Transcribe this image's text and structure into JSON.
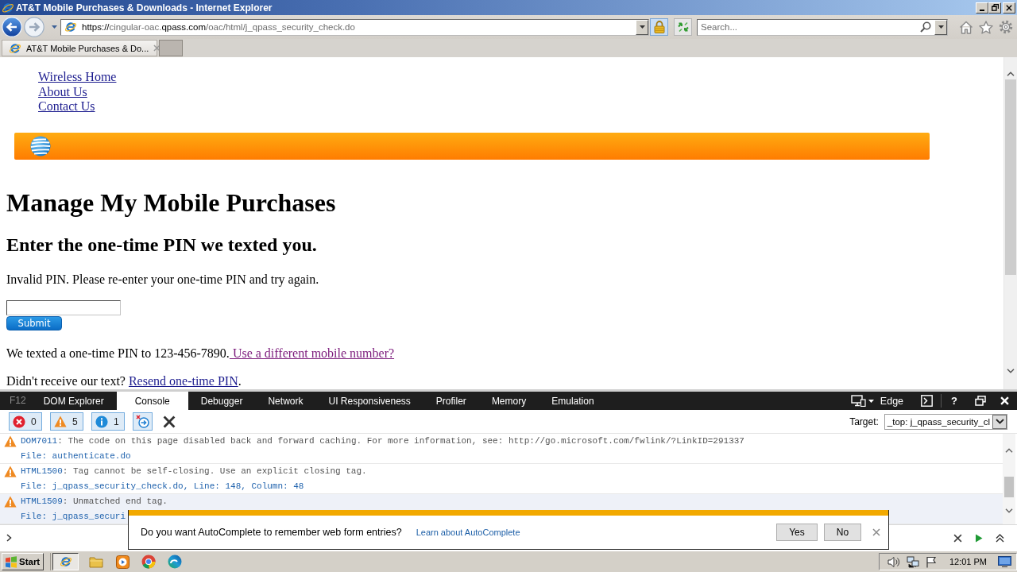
{
  "window": {
    "title": "AT&T Mobile Purchases & Downloads - Internet Explorer"
  },
  "address_bar": {
    "url": {
      "scheme": "https://",
      "host_prefix": "cingular-oac.",
      "domain": "qpass.com",
      "path": "/oac/html/j_qpass_security_check.do"
    }
  },
  "search": {
    "placeholder": "Search..."
  },
  "tabs": [
    {
      "title": "AT&T Mobile Purchases & Do...",
      "selected": true
    }
  ],
  "page": {
    "nav_links": [
      "Wireless Home",
      "About Us",
      "Contact Us"
    ],
    "heading": "Manage My Mobile Purchases",
    "subheading": "Enter the one-time PIN we texted you.",
    "error_message": "Invalid PIN. Please re-enter your one-time PIN and try again.",
    "submit_button": "Submit",
    "notes": [
      {
        "text": "We texted a one-time PIN to 123-456-7890.",
        "link": " Use a different mobile number?",
        "link_visited": true
      },
      {
        "text": "Didn't receive our text? ",
        "link": "Resend one-time PIN",
        "link_visited": false,
        "after": "."
      }
    ]
  },
  "devtools": {
    "label": "F12",
    "tabs": [
      {
        "label": "DOM Explorer",
        "selected": false
      },
      {
        "label": "Console",
        "selected": true
      },
      {
        "label": "Debugger",
        "selected": false
      },
      {
        "label": "Network",
        "selected": false
      },
      {
        "label": "UI Responsiveness",
        "selected": false
      },
      {
        "label": "Profiler",
        "selected": false
      },
      {
        "label": "Memory",
        "selected": false
      },
      {
        "label": "Emulation",
        "selected": false
      }
    ],
    "document_mode": "Edge",
    "help": "?",
    "filters": [
      {
        "kind": "error",
        "count": "0",
        "on": true
      },
      {
        "kind": "warning",
        "count": "5",
        "on": true
      },
      {
        "kind": "info",
        "count": "1",
        "on": true
      }
    ],
    "target": {
      "label": "Target:",
      "value": "_top: j_qpass_security_cl"
    },
    "messages": [
      {
        "kind": "warning",
        "code": "DOM7011",
        "text": ": The code on this page disabled back and forward caching. For more information, see: http://go.microsoft.com/fwlink/?LinkID=291337",
        "file": "File: authenticate.do",
        "selected": false
      },
      {
        "kind": "warning",
        "code": "HTML1500",
        "text": ": Tag cannot be self-closing. Use an explicit closing tag.",
        "file": "File: j_qpass_security_check.do, Line: 148, Column: 48",
        "selected": false
      },
      {
        "kind": "warning",
        "code": "HTML1509",
        "text": ": Unmatched end tag.",
        "file": "File: j_qpass_securi",
        "selected": true
      }
    ]
  },
  "autocomplete_bar": {
    "question": "Do you want AutoComplete to remember web form entries?",
    "link": "Learn about AutoComplete",
    "buttons": [
      "Yes",
      "No"
    ]
  },
  "taskbar": {
    "start": "Start",
    "apps": [
      {
        "kind": "ie",
        "selected": true
      },
      {
        "kind": "folder",
        "selected": false
      },
      {
        "kind": "media",
        "selected": false
      },
      {
        "kind": "chrome",
        "selected": false
      },
      {
        "kind": "edge",
        "selected": false
      }
    ],
    "clock": "12:01 PM"
  }
}
